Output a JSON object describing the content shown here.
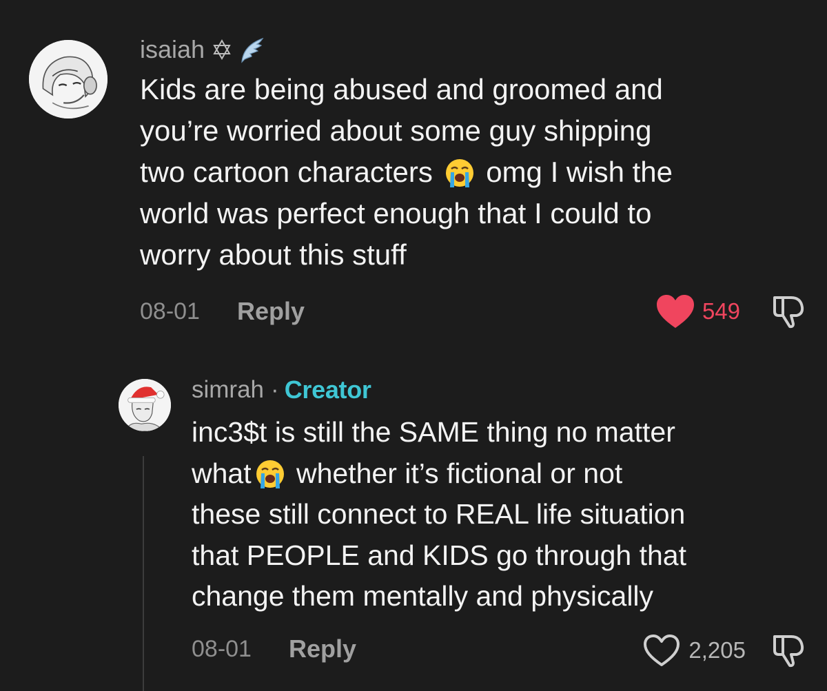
{
  "comments": [
    {
      "username": "isaiah",
      "badges": [
        "star-of-david-icon",
        "wing-icon"
      ],
      "text_lines": [
        "Kids are being abused and groomed and",
        "you’re worried about some guy shipping",
        [
          "two cartoon characters ",
          "loudly-crying-emoji",
          " omg I wish the"
        ],
        "world was perfect enough that I could to",
        "worry about this stuff"
      ],
      "date": "08-01",
      "reply_label": "Reply",
      "likes": "549",
      "liked": true
    },
    {
      "username": "simrah",
      "separator": "·",
      "role": "Creator",
      "text_lines": [
        "inc3$t is still the SAME thing no matter",
        [
          "what",
          "loudly-crying-emoji",
          " whether it’s fictional or not"
        ],
        "these still connect to REAL life situation",
        "that PEOPLE and KIDS go through that",
        "change them mentally and physically"
      ],
      "date": "08-01",
      "reply_label": "Reply",
      "likes": "2,205",
      "liked": false
    }
  ],
  "colors": {
    "background": "#1c1c1c",
    "like_active": "#f0455e",
    "creator_badge": "#3fc6d4"
  }
}
